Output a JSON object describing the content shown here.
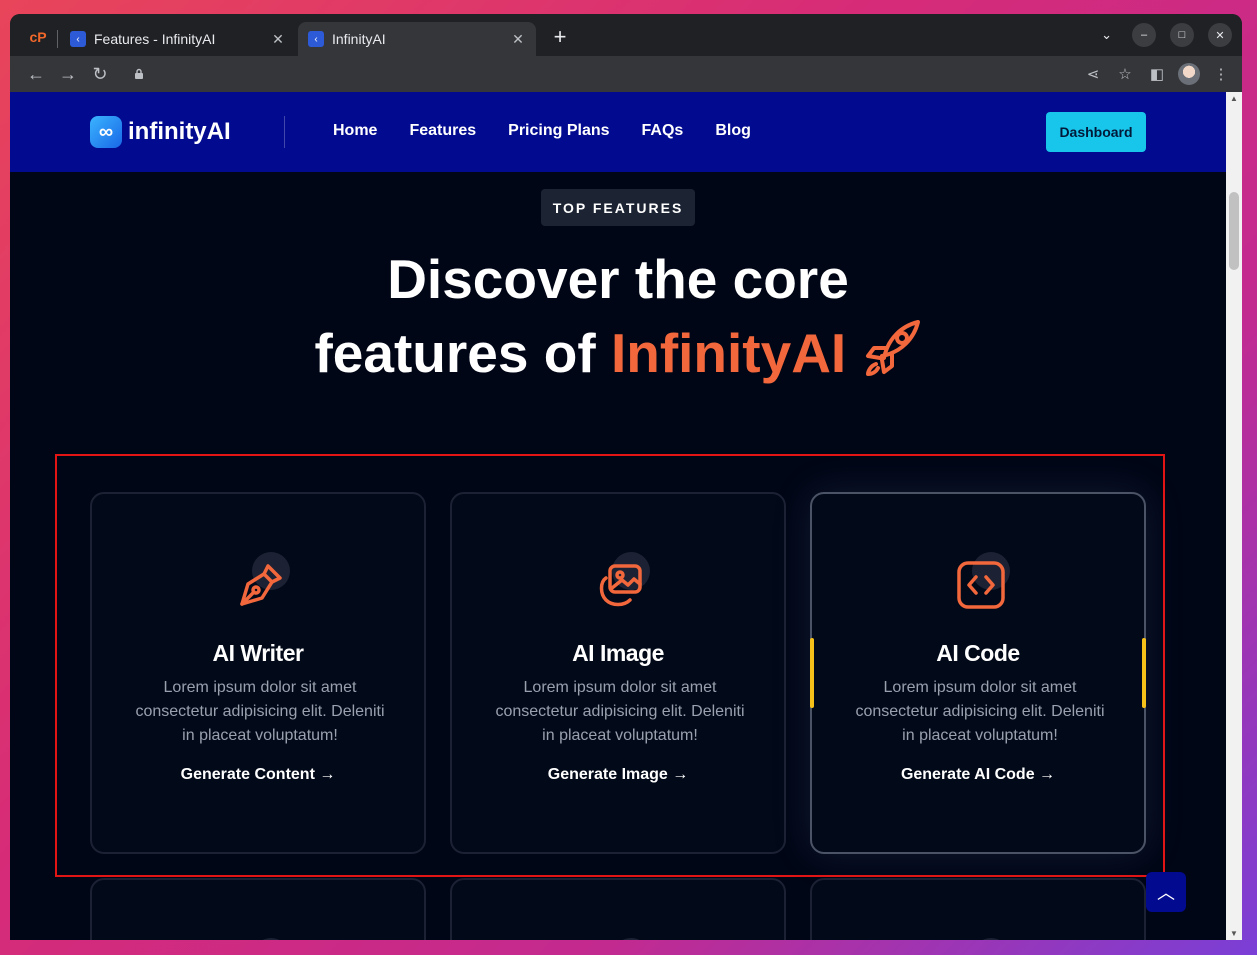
{
  "browser": {
    "tabs": [
      {
        "title": "Features - InfinityAI",
        "close": "✕"
      },
      {
        "title": "InfinityAI",
        "close": "✕"
      }
    ],
    "new_tab": "+",
    "controls": {
      "dropdown": "⌄",
      "minimize": "–",
      "maximize": "□",
      "close": "✕"
    }
  },
  "site": {
    "logo_mark": "∞",
    "logo_text": "infinityAI",
    "nav": [
      "Home",
      "Features",
      "Pricing Plans",
      "FAQs",
      "Blog"
    ],
    "dashboard_button": "Dashboard"
  },
  "hero": {
    "eyebrow": "TOP FEATURES",
    "line1": "Discover the core",
    "line2_prefix": "features of ",
    "line2_accent": "InfinityAI",
    "accent_color": "#f2683c"
  },
  "features": [
    {
      "icon": "pen-nib-icon",
      "title": "AI Writer",
      "desc": "Lorem ipsum dolor sit amet consectetur adipisicing elit. Deleniti in placeat voluptatum!",
      "cta": "Generate Content →"
    },
    {
      "icon": "image-icon",
      "title": "AI Image",
      "desc": "Lorem ipsum dolor sit amet consectetur adipisicing elit. Deleniti in placeat voluptatum!",
      "cta": "Generate Image →"
    },
    {
      "icon": "code-icon",
      "title": "AI Code",
      "desc": "Lorem ipsum dolor sit amet consectetur adipisicing elit. Deleniti in placeat voluptatum!",
      "cta": "Generate AI Code →"
    }
  ],
  "back_to_top": "︿"
}
